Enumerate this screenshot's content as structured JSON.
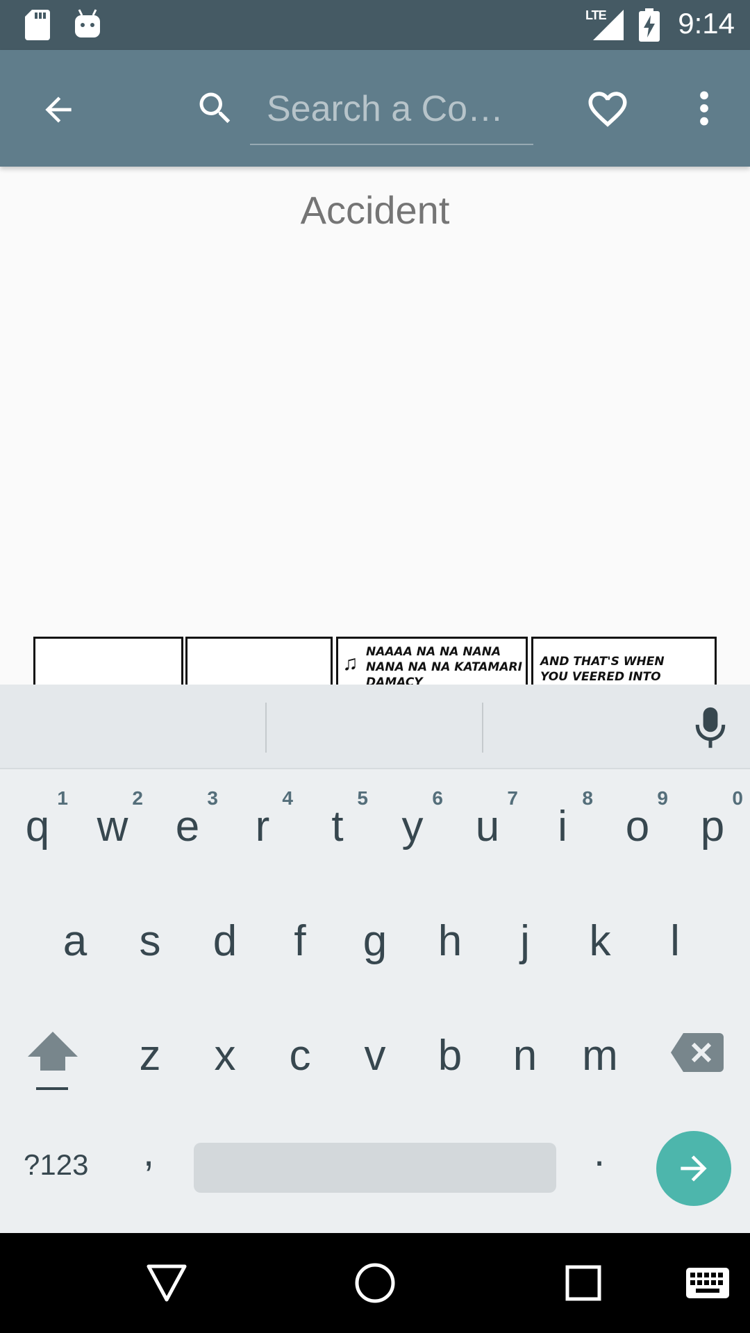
{
  "status_bar": {
    "network": "LTE",
    "time": "9:14",
    "icons": [
      "sd-card-icon",
      "android-icon",
      "signal-icon",
      "battery-charging-icon"
    ]
  },
  "app_bar": {
    "back_icon": "arrow-back-icon",
    "search_icon": "search-icon",
    "search_placeholder": "Search a Co…",
    "search_value": "",
    "favorite_icon": "heart-outline-icon",
    "overflow_icon": "more-vert-icon"
  },
  "content": {
    "comic_title": "Accident",
    "panels": [
      {
        "text": ""
      },
      {
        "text": ""
      },
      {
        "text": "NAAAA NA NA NANA NANA NA NA KATAMARI DAMACY"
      },
      {
        "text": "AND THAT'S WHEN YOU VEERED INTO"
      }
    ]
  },
  "keyboard": {
    "mic_icon": "mic-icon",
    "row1": [
      {
        "key": "q",
        "hint": "1"
      },
      {
        "key": "w",
        "hint": "2"
      },
      {
        "key": "e",
        "hint": "3"
      },
      {
        "key": "r",
        "hint": "4"
      },
      {
        "key": "t",
        "hint": "5"
      },
      {
        "key": "y",
        "hint": "6"
      },
      {
        "key": "u",
        "hint": "7"
      },
      {
        "key": "i",
        "hint": "8"
      },
      {
        "key": "o",
        "hint": "9"
      },
      {
        "key": "p",
        "hint": "0"
      }
    ],
    "row2": [
      "a",
      "s",
      "d",
      "f",
      "g",
      "h",
      "j",
      "k",
      "l"
    ],
    "row3": [
      "z",
      "x",
      "c",
      "v",
      "b",
      "n",
      "m"
    ],
    "symbols_label": "?123",
    "comma": ",",
    "period": ".",
    "shift_icon": "shift-icon",
    "backspace_icon": "backspace-icon",
    "enter_icon": "arrow-forward-icon",
    "accent_color": "#4db6ac"
  },
  "nav_bar": {
    "icons": [
      "back-triangle-icon",
      "home-circle-icon",
      "recents-square-icon",
      "keyboard-icon"
    ]
  }
}
